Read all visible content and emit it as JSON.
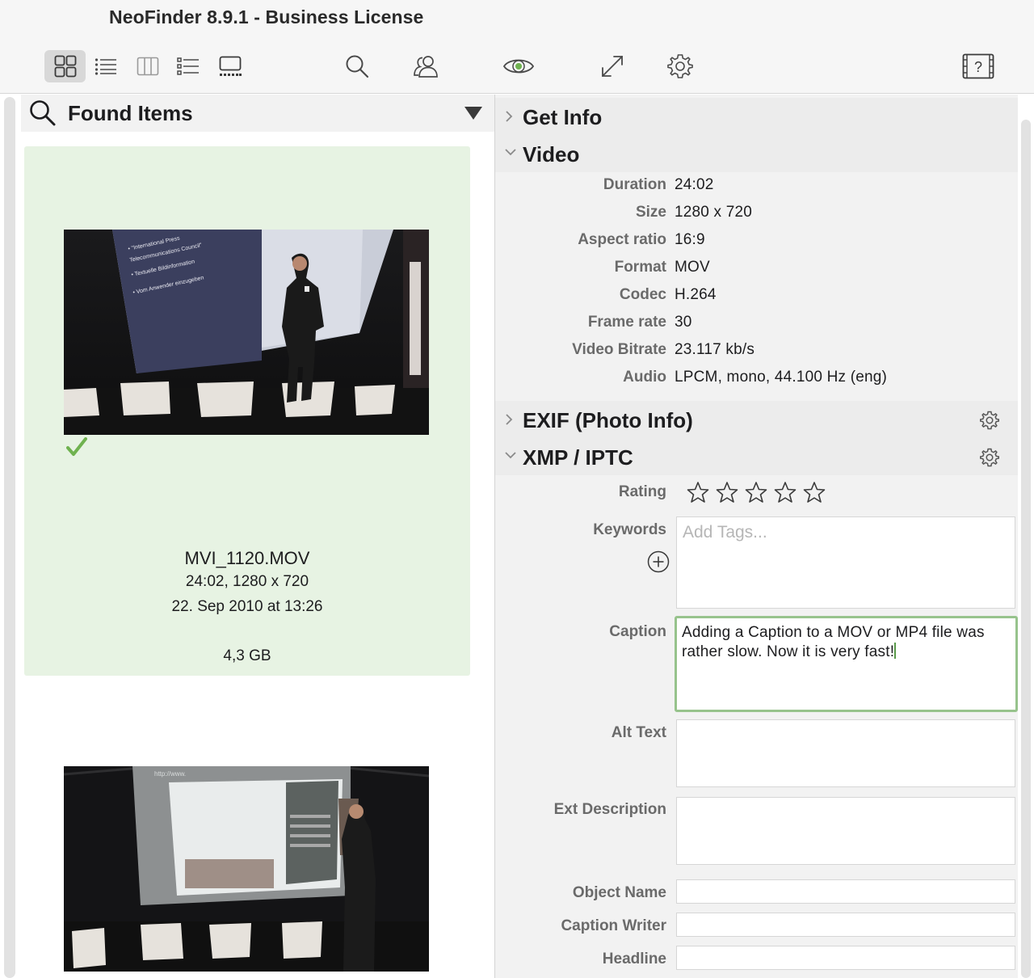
{
  "window": {
    "title": "NeoFinder 8.9.1 - Business License"
  },
  "toolbar": {
    "items": [
      {
        "icon": "grid-view-icon",
        "selected": true
      },
      {
        "icon": "list-view-icon"
      },
      {
        "icon": "column-view-icon"
      },
      {
        "icon": "outline-view-icon"
      },
      {
        "icon": "gallery-view-icon"
      },
      {
        "icon": "search-icon"
      },
      {
        "icon": "people-icon"
      },
      {
        "icon": "eye-icon"
      },
      {
        "icon": "expand-icon"
      },
      {
        "icon": "gear-icon"
      },
      {
        "icon": "help-icon"
      }
    ]
  },
  "browser": {
    "header": "Found Items",
    "items": [
      {
        "name": "MVI_1120.MOV",
        "info": "24:02, 1280 x 720",
        "date": "22. Sep 2010 at 13:26",
        "size": "4,3 GB",
        "selected": true,
        "checked": true
      },
      {
        "name": "",
        "selected": false
      }
    ]
  },
  "inspector": {
    "sections": {
      "get_info": "Get Info",
      "video": "Video",
      "exif": "EXIF (Photo Info)",
      "xmp": "XMP / IPTC"
    },
    "video": [
      {
        "label": "Duration",
        "value": "24:02"
      },
      {
        "label": "Size",
        "value": "1280 x 720"
      },
      {
        "label": "Aspect ratio",
        "value": "16:9"
      },
      {
        "label": "Format",
        "value": "MOV"
      },
      {
        "label": "Codec",
        "value": "H.264"
      },
      {
        "label": "Frame rate",
        "value": "30"
      },
      {
        "label": "Video Bitrate",
        "value": "23.117 kb/s"
      },
      {
        "label": "Audio",
        "value": "LPCM, mono, 44.100 Hz (eng)"
      }
    ],
    "xmp": {
      "rating_label": "Rating",
      "rating_value": 0,
      "rating_max": 5,
      "keywords_label": "Keywords",
      "keywords_placeholder": "Add Tags...",
      "caption_label": "Caption",
      "caption_value": "Adding a Caption to a MOV or MP4 file was rather slow. Now it is very fast!",
      "alt_text_label": "Alt Text",
      "alt_text_value": "",
      "ext_description_label": "Ext Description",
      "ext_description_value": "",
      "object_name_label": "Object Name",
      "object_name_value": "",
      "caption_writer_label": "Caption Writer",
      "caption_writer_value": "",
      "headline_label": "Headline",
      "headline_value": ""
    }
  },
  "colors": {
    "selection_bg": "#e7f3e3",
    "check_green": "#6fb24f",
    "focus_ring": "#97c38c",
    "label_gray": "#6a6a6a"
  }
}
